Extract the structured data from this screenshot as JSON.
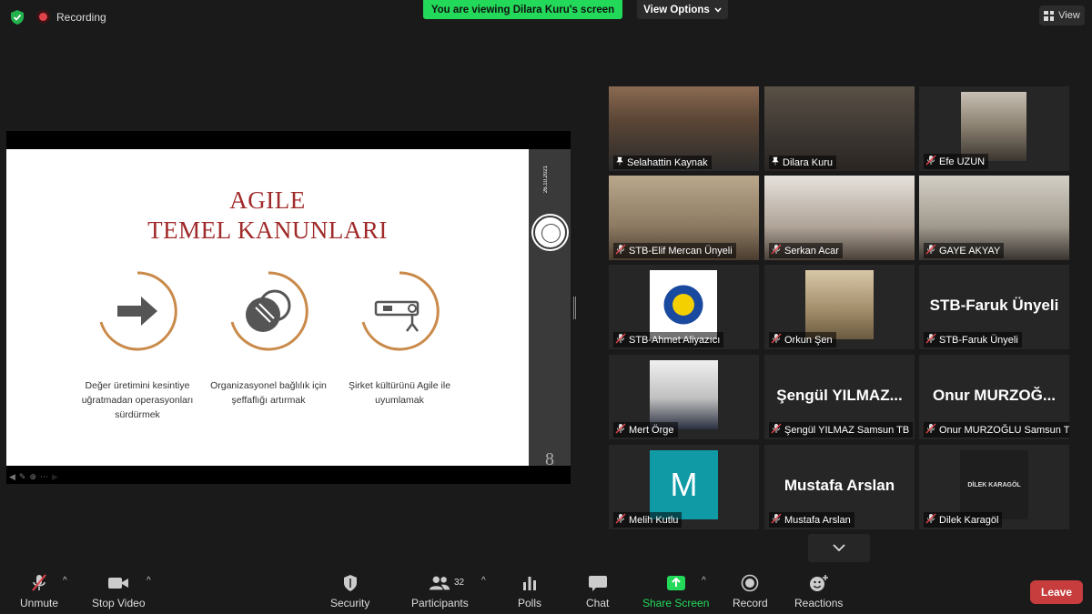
{
  "top": {
    "recording_label": "Recording",
    "viewing_banner": "You are viewing Dilara Kuru's screen",
    "view_options": "View Options",
    "view_label": "View"
  },
  "slide": {
    "date": "26.10.2021",
    "title_line1": "AGILE",
    "title_line2": "TEMEL KANUNLARI",
    "page_number": "8",
    "items": [
      {
        "text": "Değer üretimini kesintiye uğratmadan operasyonları sürdürmek",
        "icon": "arrow-right-icon"
      },
      {
        "text": "Organizasyonel bağlılık için şeffaflığı artırmak",
        "icon": "overlapping-circles-icon"
      },
      {
        "text": "Şirket kültürünü Agile ile uyumlamak",
        "icon": "telescope-icon"
      }
    ],
    "accent": "#a02a2a",
    "ring_color": "#c98a4a"
  },
  "gallery": {
    "tiles": [
      {
        "name": "Selahattin Kaynak",
        "pinned": true,
        "muted": false,
        "active": false,
        "big_name": ""
      },
      {
        "name": "Dilara Kuru",
        "pinned": true,
        "muted": false,
        "active": true,
        "big_name": ""
      },
      {
        "name": "Efe UZUN",
        "pinned": false,
        "muted": true,
        "active": false,
        "big_name": ""
      },
      {
        "name": "STB-Elif Mercan Ünyeli",
        "pinned": false,
        "muted": true,
        "active": false,
        "big_name": ""
      },
      {
        "name": "Serkan Acar",
        "pinned": false,
        "muted": true,
        "active": false,
        "big_name": ""
      },
      {
        "name": "GAYE AKYAY",
        "pinned": false,
        "muted": true,
        "active": false,
        "big_name": ""
      },
      {
        "name": "STB-Ahmet Aliyazıcı",
        "pinned": false,
        "muted": true,
        "active": false,
        "big_name": ""
      },
      {
        "name": "Orkun Şen",
        "pinned": false,
        "muted": true,
        "active": false,
        "big_name": ""
      },
      {
        "name": "STB-Faruk Ünyeli",
        "pinned": false,
        "muted": true,
        "active": false,
        "big_name": "STB-Faruk Ünyeli"
      },
      {
        "name": "Mert Örge",
        "pinned": false,
        "muted": true,
        "active": false,
        "big_name": ""
      },
      {
        "name": "Şengül YILMAZ Samsun TB",
        "pinned": false,
        "muted": true,
        "active": false,
        "big_name": "Şengül  YILMAZ..."
      },
      {
        "name": "Onur MURZOĞLU Samsun TB",
        "pinned": false,
        "muted": true,
        "active": false,
        "big_name": "Onur  MURZOĞ..."
      },
      {
        "name": "Melih Kutlu",
        "pinned": false,
        "muted": true,
        "active": false,
        "big_name": ""
      },
      {
        "name": "Mustafa Arslan",
        "pinned": false,
        "muted": true,
        "active": false,
        "big_name": "Mustafa Arslan"
      },
      {
        "name": "Dilek Karagöl",
        "pinned": false,
        "muted": true,
        "active": false,
        "big_name": ""
      }
    ],
    "avatar_letter": "M",
    "avatar_color": "#0f9aa6",
    "logo_card_text": "DİLEK KARAGÖL",
    "active_color": "#c5e84a"
  },
  "toolbar": {
    "unmute": "Unmute",
    "stop_video": "Stop Video",
    "security": "Security",
    "participants": "Participants",
    "participants_count": "32",
    "polls": "Polls",
    "chat": "Chat",
    "share_screen": "Share Screen",
    "record": "Record",
    "reactions": "Reactions",
    "leave": "Leave",
    "share_color": "#23d959",
    "leave_color": "#c73c3c"
  }
}
